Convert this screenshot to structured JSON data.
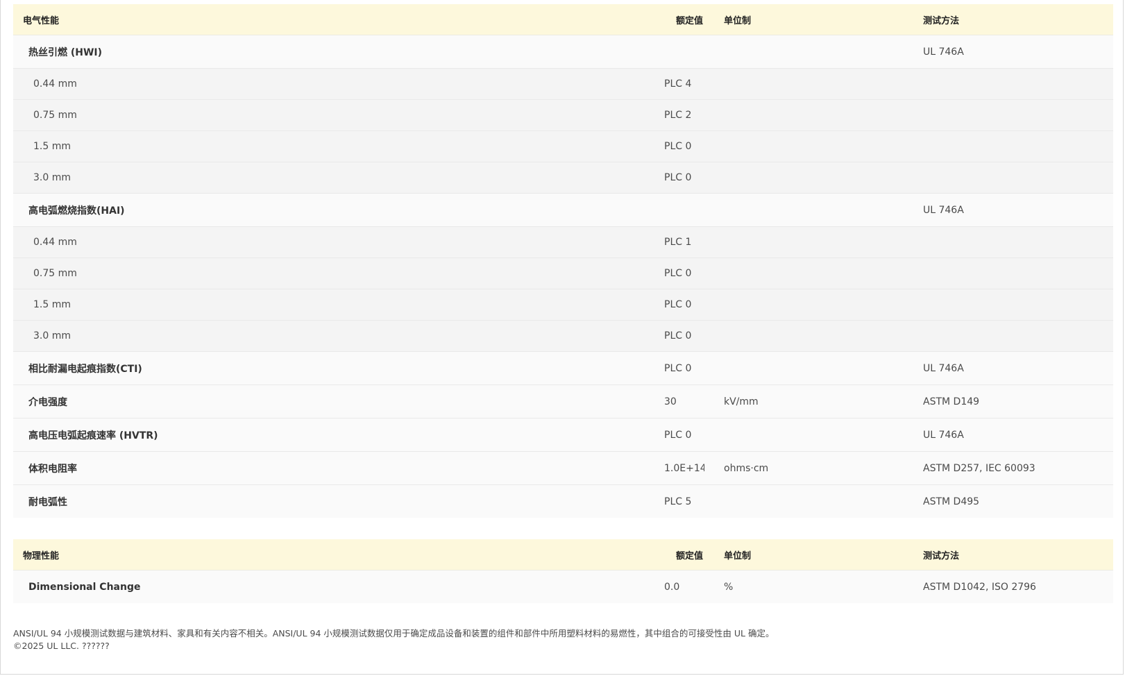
{
  "electrical": {
    "headers": [
      "电气性能",
      "额定值",
      "单位制",
      "测试方法"
    ],
    "rows": [
      {
        "name": "热丝引燃 (HWI)",
        "value": "",
        "unit": "",
        "method": "UL 746A",
        "kind": "grp"
      },
      {
        "name": "0.44 mm",
        "value": "PLC 4",
        "unit": "",
        "method": "",
        "kind": "sub"
      },
      {
        "name": "0.75 mm",
        "value": "PLC 2",
        "unit": "",
        "method": "",
        "kind": "sub"
      },
      {
        "name": "1.5 mm",
        "value": "PLC 0",
        "unit": "",
        "method": "",
        "kind": "sub"
      },
      {
        "name": "3.0 mm",
        "value": "PLC 0",
        "unit": "",
        "method": "",
        "kind": "sub"
      },
      {
        "name": "高电弧燃烧指数(HAI)",
        "value": "",
        "unit": "",
        "method": "UL 746A",
        "kind": "grp"
      },
      {
        "name": "0.44 mm",
        "value": "PLC 1",
        "unit": "",
        "method": "",
        "kind": "sub"
      },
      {
        "name": "0.75 mm",
        "value": "PLC 0",
        "unit": "",
        "method": "",
        "kind": "sub"
      },
      {
        "name": "1.5 mm",
        "value": "PLC 0",
        "unit": "",
        "method": "",
        "kind": "sub"
      },
      {
        "name": "3.0 mm",
        "value": "PLC 0",
        "unit": "",
        "method": "",
        "kind": "sub"
      },
      {
        "name": "相比耐漏电起痕指数(CTI)",
        "value": "PLC 0",
        "unit": "",
        "method": "UL 746A",
        "kind": "grp"
      },
      {
        "name": "介电强度",
        "value": "30",
        "unit": "kV/mm",
        "method": "ASTM D149",
        "kind": "grp"
      },
      {
        "name": "高电压电弧起痕速率 (HVTR)",
        "value": "PLC 0",
        "unit": "",
        "method": "UL 746A",
        "kind": "grp"
      },
      {
        "name": "体积电阻率",
        "value": "1.0E+14",
        "unit": "ohms·cm",
        "method": "ASTM D257, IEC 60093",
        "kind": "grp"
      },
      {
        "name": "耐电弧性",
        "value": "PLC 5",
        "unit": "",
        "method": "ASTM D495",
        "kind": "grp"
      }
    ]
  },
  "physical": {
    "headers": [
      "物理性能",
      "额定值",
      "单位制",
      "测试方法"
    ],
    "rows": [
      {
        "name": "Dimensional Change",
        "value": "0.0",
        "unit": "%",
        "method": "ASTM D1042, ISO 2796",
        "kind": "grp"
      }
    ]
  },
  "footer": {
    "disclaimer": "ANSI/UL 94 小规模测试数据与建筑材料、家具和有关内容不相关。ANSI/UL 94 小规模测试数据仅用于确定成品设备和装置的组件和部件中所用塑料材料的易燃性，其中组合的可接受性由 UL 确定。",
    "copyright": "©2025 UL LLC. ??????"
  }
}
